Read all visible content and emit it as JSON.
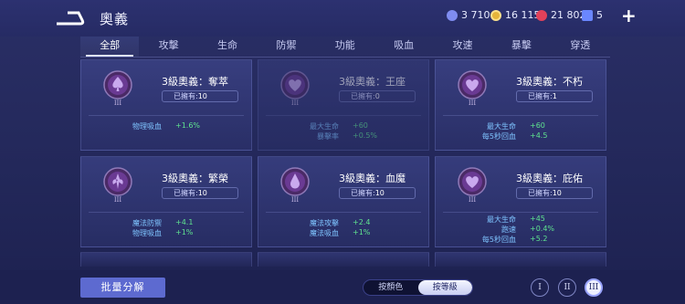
{
  "header": {
    "title": "奧義",
    "resources": [
      {
        "icon": "coin-icon",
        "value": "3 710",
        "color": "#7f8cf0"
      },
      {
        "icon": "gold-medal-icon",
        "value": "16 115",
        "color": "#e5b43a"
      },
      {
        "icon": "ruby-icon",
        "value": "21 802",
        "color": "#e2415a"
      },
      {
        "icon": "ticket-icon",
        "value": "5",
        "color": "#6a86ff"
      }
    ],
    "plus_label": "+"
  },
  "tabs": [
    "全部",
    "攻擊",
    "生命",
    "防禦",
    "功能",
    "吸血",
    "攻速",
    "暴擊",
    "穿透"
  ],
  "cards": [
    {
      "name": "3級奧義：奪萃",
      "owned_label": "已擁有:",
      "owned_count": "10",
      "stats": [
        {
          "k": "物理吸血",
          "v": "+1.6%"
        }
      ]
    },
    {
      "name": "3級奧義：王座",
      "owned_label": "已擁有:",
      "owned_count": "0",
      "stats": [
        {
          "k": "最大生命",
          "v": "+60"
        },
        {
          "k": "暴擊率",
          "v": "+0.5%"
        }
      ]
    },
    {
      "name": "3級奧義：不朽",
      "owned_label": "已擁有:",
      "owned_count": "1",
      "stats": [
        {
          "k": "最大生命",
          "v": "+60"
        },
        {
          "k": "每5秒回血",
          "v": "+4.5"
        }
      ]
    },
    {
      "name": "3級奧義：繁榮",
      "owned_label": "已擁有:",
      "owned_count": "10",
      "stats": [
        {
          "k": "魔法防禦",
          "v": "+4.1"
        },
        {
          "k": "物理吸血",
          "v": "+1%"
        }
      ]
    },
    {
      "name": "3級奧義：血魔",
      "owned_label": "已擁有:",
      "owned_count": "10",
      "stats": [
        {
          "k": "魔法攻擊",
          "v": "+2.4"
        },
        {
          "k": "魔法吸血",
          "v": "+1%"
        }
      ]
    },
    {
      "name": "3級奧義：庇佑",
      "owned_label": "已擁有:",
      "owned_count": "10",
      "stats": [
        {
          "k": "最大生命",
          "v": "+45"
        },
        {
          "k": "跑速",
          "v": "+0.4%"
        },
        {
          "k": "每5秒回血",
          "v": "+5.2"
        }
      ]
    }
  ],
  "emblem_level": "III",
  "footer": {
    "bulk_label": "批量分解",
    "sort_options": [
      "按顏色",
      "按等級"
    ],
    "sort_selected": "按等級",
    "levels": [
      "I",
      "II",
      "III"
    ],
    "level_selected": "III"
  }
}
